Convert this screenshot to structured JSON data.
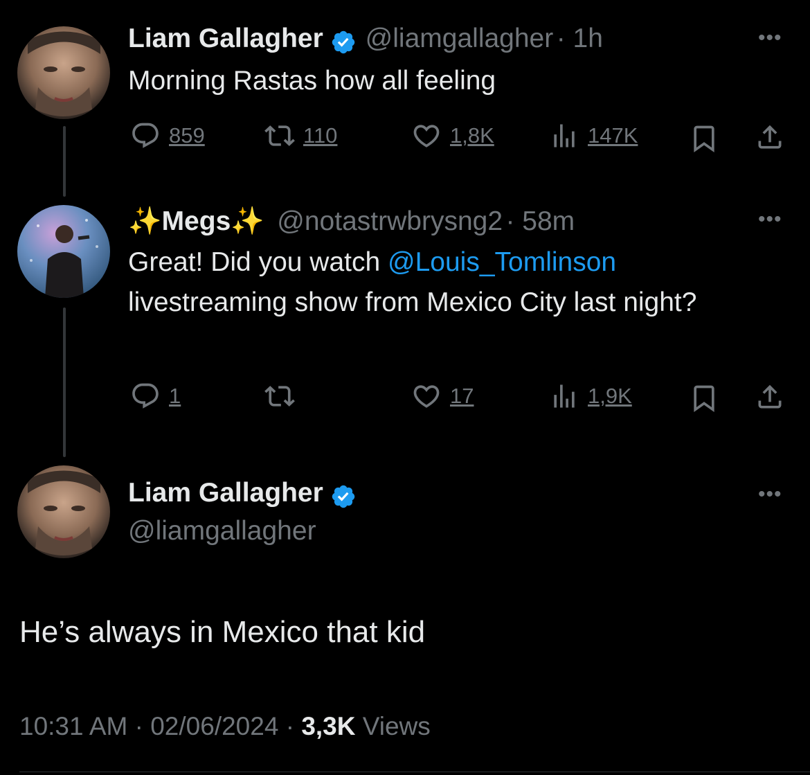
{
  "tweets": [
    {
      "name": "Liam Gallagher",
      "handle": "@liamgallagher",
      "time": "· 1h",
      "text": "Morning Rastas how all feeling",
      "actions": {
        "replies": "859",
        "retweets": "110",
        "likes": "1,8K",
        "views": "147K"
      }
    },
    {
      "name_prefix": "✨",
      "name": "Megs",
      "name_suffix": "✨",
      "handle": "@notastrwbrysng2",
      "time": "· 58m",
      "text_before": "Great! Did you watch ",
      "mention": "@Louis_Tomlinson",
      "text_after": " livestreaming show from Mexico City last night?",
      "actions": {
        "replies": "1",
        "retweets": "",
        "likes": "17",
        "views": "1,9K"
      }
    }
  ],
  "main_tweet": {
    "name": "Liam Gallagher",
    "handle": "@liamgallagher",
    "text": "He’s always in Mexico that kid",
    "time": "10:31 AM",
    "date": "02/06/2024",
    "views_count": "3,3K",
    "views_label": "Views"
  },
  "icons": {
    "more": "more-icon",
    "reply": "reply-icon",
    "retweet": "retweet-icon",
    "like": "heart-icon",
    "views": "views-icon",
    "bookmark": "bookmark-icon",
    "share": "share-icon",
    "verified": "verified-icon"
  },
  "colors": {
    "background": "#000000",
    "text": "#e7e9ea",
    "muted": "#71767b",
    "accent": "#1d9bf0"
  }
}
